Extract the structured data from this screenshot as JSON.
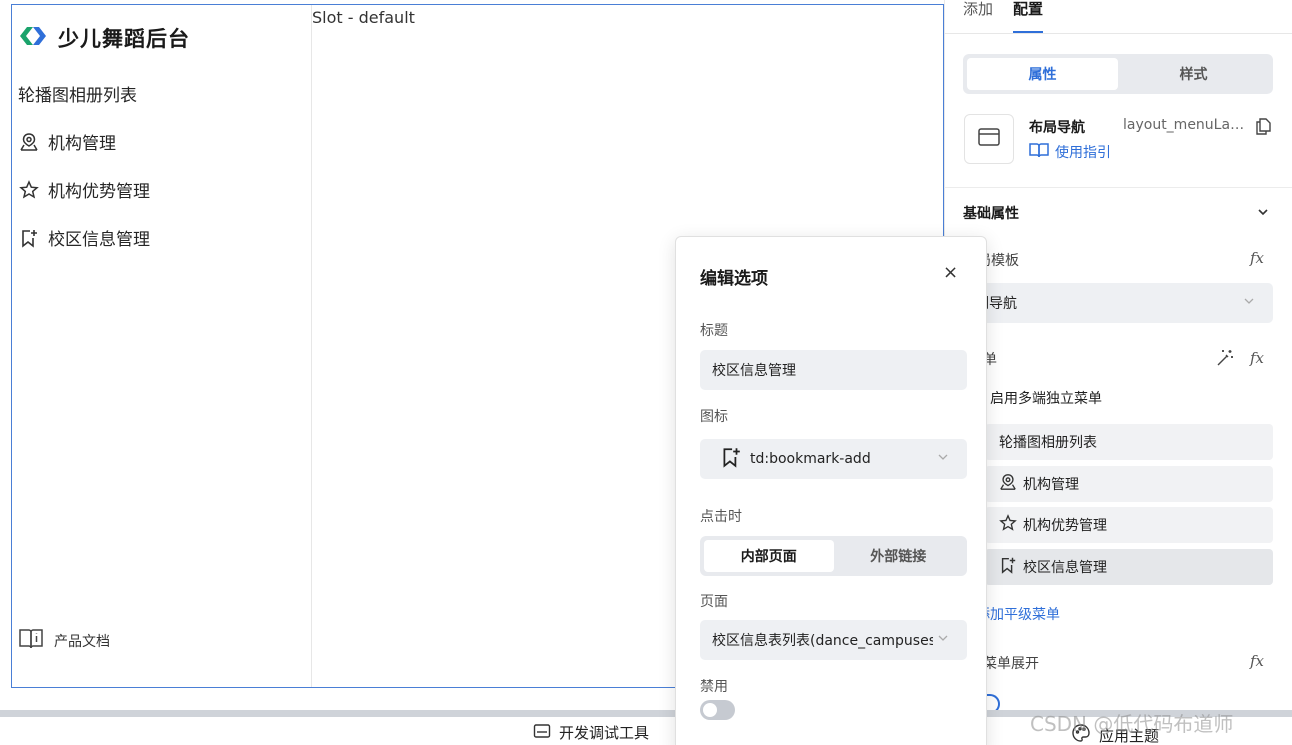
{
  "canvas": {
    "brand": {
      "title": "少儿舞蹈后台"
    },
    "nav": [
      {
        "label": "轮播图相册列表",
        "icon": "none"
      },
      {
        "label": "机构管理",
        "icon": "location-user-icon"
      },
      {
        "label": "机构优势管理",
        "icon": "star-icon"
      },
      {
        "label": "校区信息管理",
        "icon": "bookmark-add-icon"
      }
    ],
    "footer_link": "产品文档",
    "slot_label": "Slot - default"
  },
  "right_panel": {
    "tabs": [
      "添加",
      "配置"
    ],
    "active_tab": "配置",
    "segment": [
      "属性",
      "样式"
    ],
    "component_name": "布局导航",
    "component_id": "layout_menuLayout",
    "guide_link": "使用指引",
    "section_title": "基础属性",
    "template_label": "局模板",
    "template_value": "侧导航",
    "menu_label": "单",
    "multi_menu_label": "启用多端独立菜单",
    "menu_items": [
      "轮播图相册列表",
      "机构管理",
      "机构优势管理",
      "校区信息管理"
    ],
    "add_sibling": "添加平级菜单",
    "expand_label": "菜单展开"
  },
  "popover": {
    "title": "编辑选项",
    "close": "×",
    "title_label": "标题",
    "title_value": "校区信息管理",
    "icon_label": "图标",
    "icon_value": "td:bookmark-add",
    "click_label": "点击时",
    "click_options": [
      "内部页面",
      "外部链接"
    ],
    "page_label": "页面",
    "page_value": "校区信息表列表(dance_campuses",
    "disabled_label": "禁用"
  },
  "bottom_bar": {
    "dev_tools": "开发调试工具",
    "apply_theme": "应用主题",
    "watermark": "CSDN @低代码布道师"
  },
  "colors": {
    "accent": "#2f6fd9",
    "brand_green": "#1aa36b",
    "brand_blue": "#2f6fd9"
  }
}
